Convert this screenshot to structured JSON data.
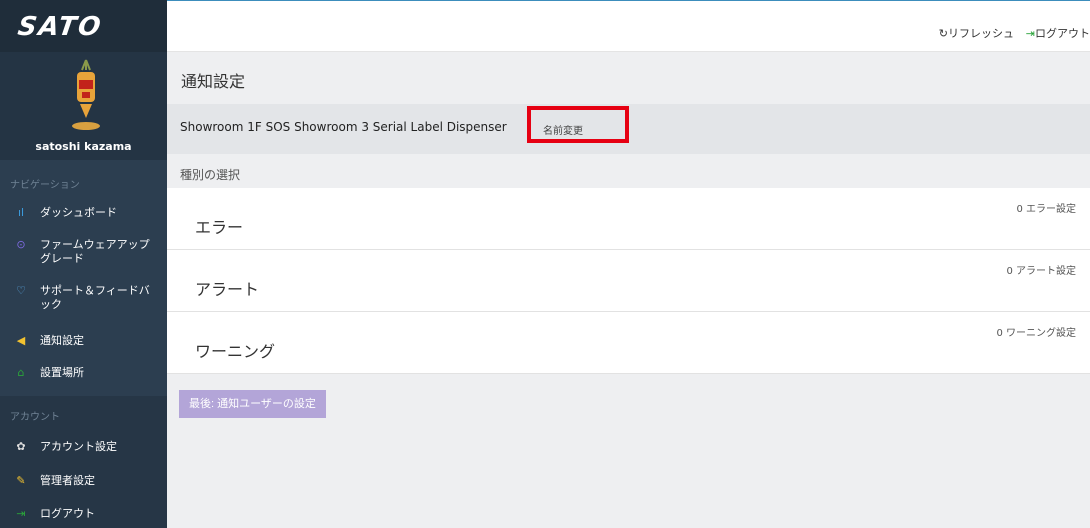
{
  "brand": {
    "logo": "SATO"
  },
  "user": {
    "name": "satoshi kazama"
  },
  "sidebar": {
    "nav_heading": "ナビゲーション",
    "nav_items": [
      {
        "label": "ダッシュボード",
        "icon": "bar-chart-icon"
      },
      {
        "label": "ファームウェアアップグレード",
        "icon": "upload-circle-icon"
      },
      {
        "label": "サポート＆フィードバック",
        "icon": "heart-icon"
      },
      {
        "label": "通知設定",
        "icon": "megaphone-icon"
      },
      {
        "label": "設置場所",
        "icon": "home-icon"
      }
    ],
    "account_heading": "アカウント",
    "account_items": [
      {
        "label": "アカウント設定",
        "icon": "gear-icon"
      },
      {
        "label": "管理者設定",
        "icon": "wrench-icon"
      },
      {
        "label": "ログアウト",
        "icon": "logout-icon"
      }
    ]
  },
  "header": {
    "refresh": "リフレッシュ",
    "logout": "ログアウト"
  },
  "page": {
    "title": "通知設定",
    "device_name": "Showroom 1F SOS Showroom 3 Serial Label Dispenser",
    "rename": "名前変更",
    "section_label": "種別の選択",
    "types": [
      {
        "name": "エラー",
        "count": "0 エラー設定"
      },
      {
        "name": "アラート",
        "count": "0 アラート設定"
      },
      {
        "name": "ワーニング",
        "count": "0 ワーニング設定"
      }
    ],
    "next_button": "最後: 通知ユーザーの設定"
  },
  "colors": {
    "sidebar_bg": "#2c3e50",
    "highlight": "#e60012",
    "button": "#b3a5d8"
  }
}
